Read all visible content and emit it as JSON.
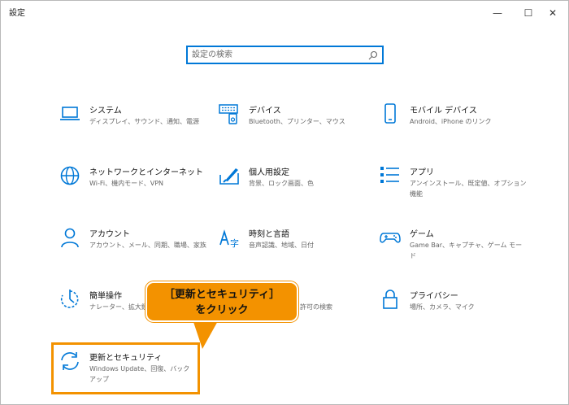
{
  "window": {
    "title": "設定",
    "controls": {
      "minimize": "—",
      "maximize": "☐",
      "close": "✕"
    }
  },
  "search": {
    "placeholder": "設定の検索"
  },
  "accent_color": "#0078d7",
  "items": [
    {
      "icon": "laptop-icon",
      "title": "システム",
      "desc": "ディスプレイ、サウンド、通知、電源"
    },
    {
      "icon": "keyboard-icon",
      "title": "デバイス",
      "desc": "Bluetooth、プリンター、マウス"
    },
    {
      "icon": "phone-icon",
      "title": "モバイル デバイス",
      "desc": "Android、iPhone のリンク"
    },
    {
      "icon": "globe-icon",
      "title": "ネットワークとインターネット",
      "desc": "Wi-Fi、機内モード、VPN"
    },
    {
      "icon": "paint-icon",
      "title": "個人用設定",
      "desc": "背景、ロック画面、色"
    },
    {
      "icon": "apps-icon",
      "title": "アプリ",
      "desc": "アンインストール、既定値、オプション機能"
    },
    {
      "icon": "person-icon",
      "title": "アカウント",
      "desc": "アカウント、メール、同期、職場、家族"
    },
    {
      "icon": "language-icon",
      "title": "時刻と言語",
      "desc": "音声認識、地域、日付"
    },
    {
      "icon": "gamepad-icon",
      "title": "ゲーム",
      "desc": "Game Bar、キャプチャ、ゲーム モード"
    },
    {
      "icon": "ease-of-access-icon",
      "title": "簡単操作",
      "desc": "ナレーター、拡大鏡、"
    },
    {
      "icon": "search-icon",
      "title": "",
      "desc": "セス許可の検索"
    },
    {
      "icon": "lock-icon",
      "title": "プライバシー",
      "desc": "場所、カメラ、マイク"
    },
    {
      "icon": "sync-icon",
      "title": "更新とセキュリティ",
      "desc": "Windows Update、回復、バックアップ"
    }
  ],
  "callout": {
    "text": "［更新とセキュリティ］\nをクリック",
    "color": "#f39200"
  }
}
